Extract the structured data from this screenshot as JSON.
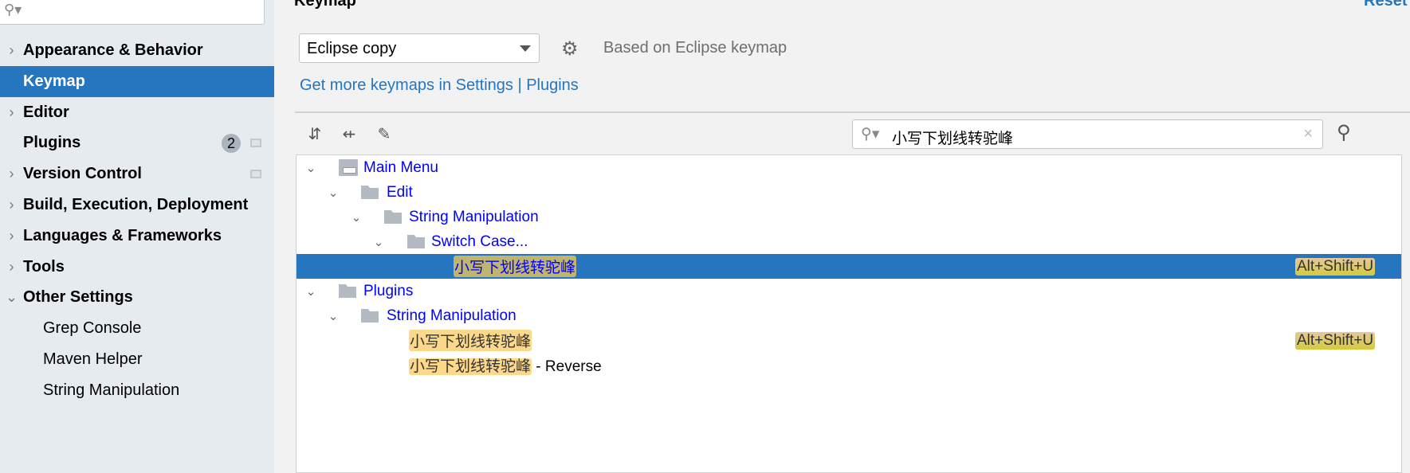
{
  "sidebar": {
    "search_placeholder": "",
    "items": [
      {
        "label": "Appearance & Behavior",
        "expanded": false
      },
      {
        "label": "Keymap",
        "selected": true
      },
      {
        "label": "Editor",
        "expanded": false
      },
      {
        "label": "Plugins",
        "badge": "2"
      },
      {
        "label": "Version Control",
        "expanded": false
      },
      {
        "label": "Build, Execution, Deployment",
        "expanded": false
      },
      {
        "label": "Languages & Frameworks",
        "expanded": false
      },
      {
        "label": "Tools",
        "expanded": false
      },
      {
        "label": "Other Settings",
        "expanded": true
      },
      {
        "label": "Grep Console"
      },
      {
        "label": "Maven Helper"
      },
      {
        "label": "String Manipulation"
      }
    ]
  },
  "header": {
    "title": "Keymap",
    "reset": "Reset"
  },
  "keymap": {
    "selected": "Eclipse copy",
    "based_on": "Based on Eclipse keymap",
    "link": "Get more keymaps in Settings | Plugins"
  },
  "search": {
    "value": "小写下划线转驼峰"
  },
  "tree": [
    {
      "label": "Main Menu"
    },
    {
      "label": "Edit"
    },
    {
      "label": "String Manipulation"
    },
    {
      "label": "Switch Case..."
    },
    {
      "match": "小写下划线转驼峰",
      "shortcut": "Alt+Shift+U",
      "selected": true
    },
    {
      "label": "Plugins"
    },
    {
      "label": "String Manipulation"
    },
    {
      "match": "小写下划线转驼峰",
      "shortcut": "Alt+Shift+U"
    },
    {
      "match": "小写下划线转驼峰",
      "suffix": " - Reverse"
    }
  ],
  "colors": {
    "accent": "#2675bf",
    "highlight": "#fcd98a",
    "link": "#0000ff"
  }
}
